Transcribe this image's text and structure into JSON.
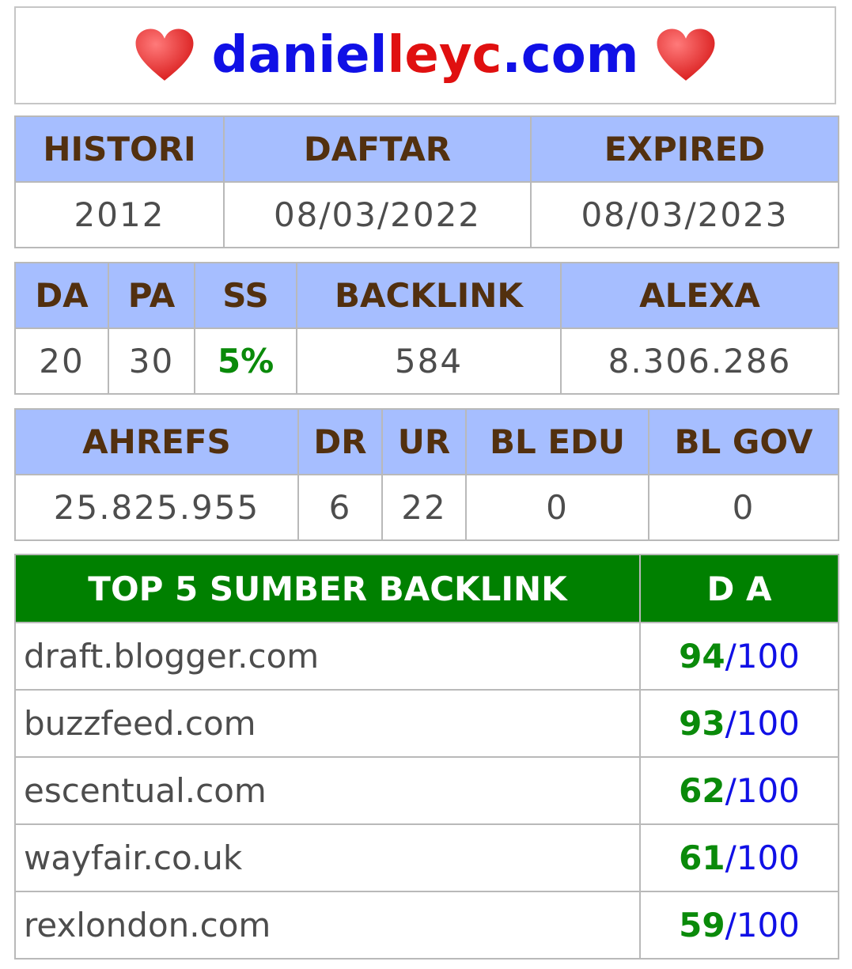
{
  "site": {
    "part1": "daniel",
    "part2": "leyc",
    "part3": ".com"
  },
  "icons": {
    "heart": "heart-icon",
    "heart_color": "#e82a2a"
  },
  "colors": {
    "header_bg": "#a6beff",
    "header_text": "#52300f",
    "accent_green": "#008000",
    "link_blue": "#1010e6"
  },
  "domain_info": {
    "headers": [
      "HISTORI",
      "DAFTAR",
      "EXPIRED"
    ],
    "values": [
      "2012",
      "08/03/2022",
      "08/03/2023"
    ]
  },
  "moz_info": {
    "headers": [
      "DA",
      "PA",
      "SS",
      "BACKLINK",
      "ALEXA"
    ],
    "values": [
      "20",
      "30",
      "5%",
      "584",
      "8.306.286"
    ]
  },
  "ahrefs_info": {
    "headers": [
      "AHREFS",
      "DR",
      "UR",
      "BL EDU",
      "BL GOV"
    ],
    "values": [
      "25.825.955",
      "6",
      "22",
      "0",
      "0"
    ]
  },
  "top_backlinks": {
    "headers": [
      "TOP 5 SUMBER BACKLINK",
      "D A"
    ],
    "separator": "/",
    "rows": [
      {
        "source": "draft.blogger.com",
        "da": "94",
        "max": "100"
      },
      {
        "source": "buzzfeed.com",
        "da": "93",
        "max": "100"
      },
      {
        "source": "escentual.com",
        "da": "62",
        "max": "100"
      },
      {
        "source": "wayfair.co.uk",
        "da": "61",
        "max": "100"
      },
      {
        "source": "rexlondon.com",
        "da": "59",
        "max": "100"
      }
    ]
  }
}
